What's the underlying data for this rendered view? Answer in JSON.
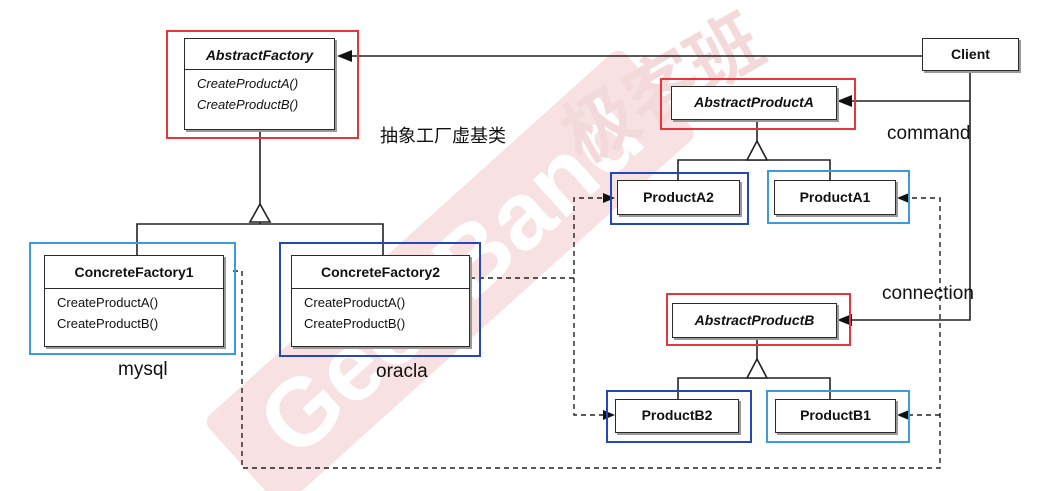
{
  "diagram": {
    "abstract_factory": {
      "title": "AbstractFactory",
      "ops": [
        "CreateProductA()",
        "CreateProductB()"
      ]
    },
    "client": {
      "title": "Client"
    },
    "abstract_product_a": {
      "title": "AbstractProductA"
    },
    "abstract_product_b": {
      "title": "AbstractProductB"
    },
    "product_a2": {
      "title": "ProductA2"
    },
    "product_a1": {
      "title": "ProductA1"
    },
    "product_b2": {
      "title": "ProductB2"
    },
    "product_b1": {
      "title": "ProductB1"
    },
    "concrete_factory_1": {
      "title": "ConcreteFactory1",
      "ops": [
        "CreateProductA()",
        "CreateProductB()"
      ]
    },
    "concrete_factory_2": {
      "title": "ConcreteFactory2",
      "ops": [
        "CreateProductA()",
        "CreateProductB()"
      ]
    }
  },
  "annotations": {
    "abstract_factory_note": "抽象工厂虚基类",
    "command": "command",
    "connection": "connection",
    "mysql": "mysql",
    "oracla": "oracla"
  },
  "watermark": {
    "logo_text": "GeekBand",
    "cn_text": "极客班"
  },
  "colors": {
    "red_highlight": "#e8343b",
    "blue_highlight": "#3d9bd9",
    "navy_highlight": "#2448b8",
    "watermark": "#f3d3d4"
  }
}
